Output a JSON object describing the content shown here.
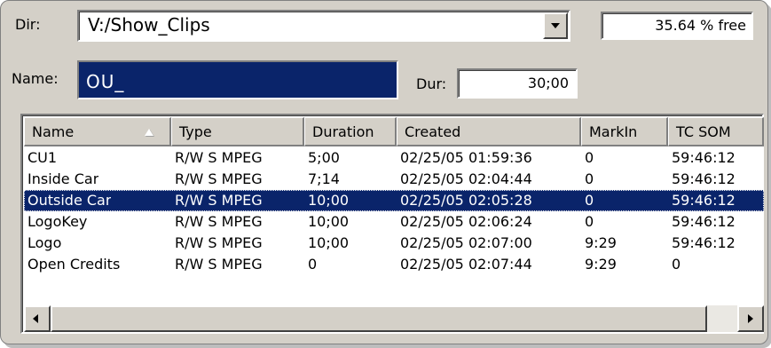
{
  "dir": {
    "label": "Dir:",
    "value": "V:/Show_Clips"
  },
  "free_space": "35.64 % free",
  "name": {
    "label": "Name:",
    "value": "OU_"
  },
  "duration": {
    "label": "Dur:",
    "value": "30;00"
  },
  "columns": [
    "Name",
    "Type",
    "Duration",
    "Created",
    "MarkIn",
    "TC SOM"
  ],
  "rows": [
    [
      "CU1",
      "R/W S MPEG",
      "5;00",
      "02/25/05 01:59:36",
      "0",
      "59:46:12"
    ],
    [
      "Inside Car",
      "R/W S MPEG",
      "7;14",
      "02/25/05 02:04:44",
      "0",
      "59:46:12"
    ],
    [
      "Outside Car",
      "R/W S MPEG",
      "10;00",
      "02/25/05 02:05:28",
      "0",
      "59:46:12"
    ],
    [
      "LogoKey",
      "R/W S MPEG",
      "10;00",
      "02/25/05 02:06:24",
      "0",
      "59:46:12"
    ],
    [
      "Logo",
      "R/W S MPEG",
      "10;00",
      "02/25/05 02:07:00",
      "9:29",
      "59:46:12"
    ],
    [
      "Open Credits",
      "R/W S MPEG",
      "0",
      "02/25/05 02:07:44",
      "9:29",
      "0"
    ]
  ],
  "selected_row": 2,
  "colors": {
    "panel": "#d4d0c8",
    "selection": "#0a246a"
  }
}
